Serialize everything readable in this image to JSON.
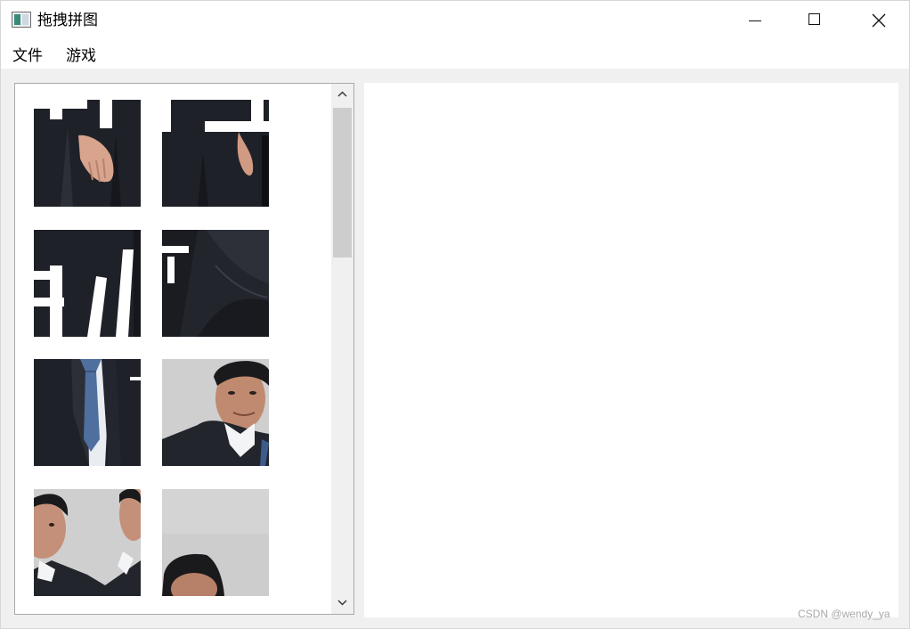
{
  "window": {
    "title": "拖拽拼图",
    "icon": "puzzle-app-icon",
    "controls": [
      "minimize-icon",
      "maximize-icon",
      "close-icon"
    ]
  },
  "menu": {
    "file": "文件",
    "game": "游戏"
  },
  "pieces_list": {
    "visible_pieces": [
      {
        "content": "suit bottom with hand"
      },
      {
        "content": "suit bottom with hand right"
      },
      {
        "content": "suit with white lettering"
      },
      {
        "content": "suit sleeve"
      },
      {
        "content": "suit and blue tie"
      },
      {
        "content": "man face right"
      },
      {
        "content": "two faces"
      },
      {
        "content": "head top on grey"
      }
    ]
  },
  "watermark": "CSDN @wendy_ya",
  "colors": {
    "background": "#f0f0f0",
    "suit": "#22252c",
    "photo_bg": "#cfcfcf",
    "tie": "#4f6f9e"
  }
}
